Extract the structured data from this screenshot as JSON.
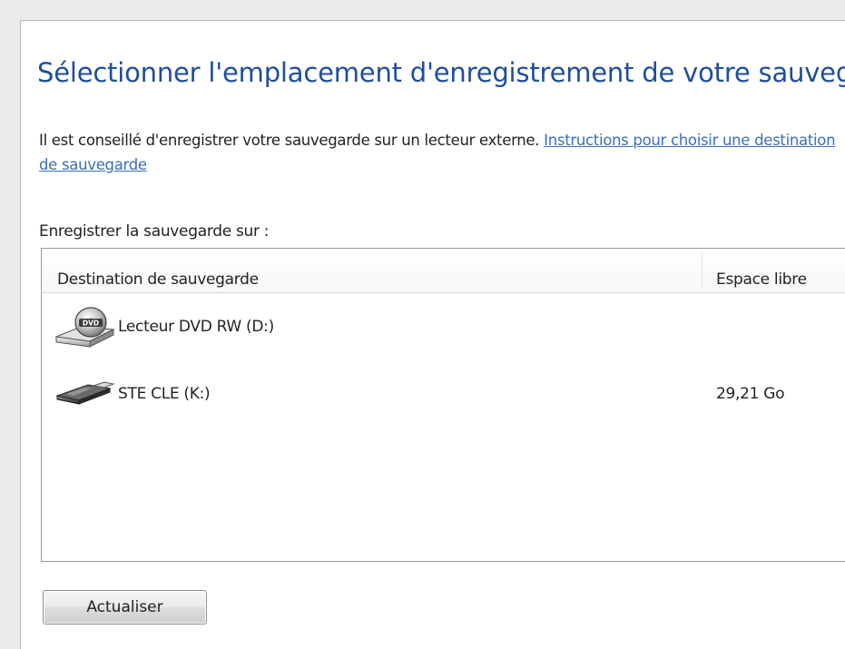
{
  "dialog": {
    "title": "Sélectionner l'emplacement d'enregistrement de votre sauvegarde",
    "intro_text": "Il est conseillé d'enregistrer votre sauvegarde sur un lecteur externe. ",
    "intro_link": "Instructions pour choisir une destination de sauvegarde",
    "save_on_label": "Enregistrer la sauvegarde sur :"
  },
  "list": {
    "columns": {
      "destination": "Destination de sauvegarde",
      "free_space": "Espace libre"
    },
    "rows": [
      {
        "name": "Lecteur DVD RW (D:)",
        "free_space": "",
        "icon": "dvd-drive-icon"
      },
      {
        "name": "STE CLE (K:)",
        "free_space": "29,21 Go",
        "icon": "usb-drive-icon"
      }
    ]
  },
  "buttons": {
    "refresh": "Actualiser"
  },
  "colors": {
    "title": "#1f4e9c",
    "link": "#3a6fb8"
  }
}
